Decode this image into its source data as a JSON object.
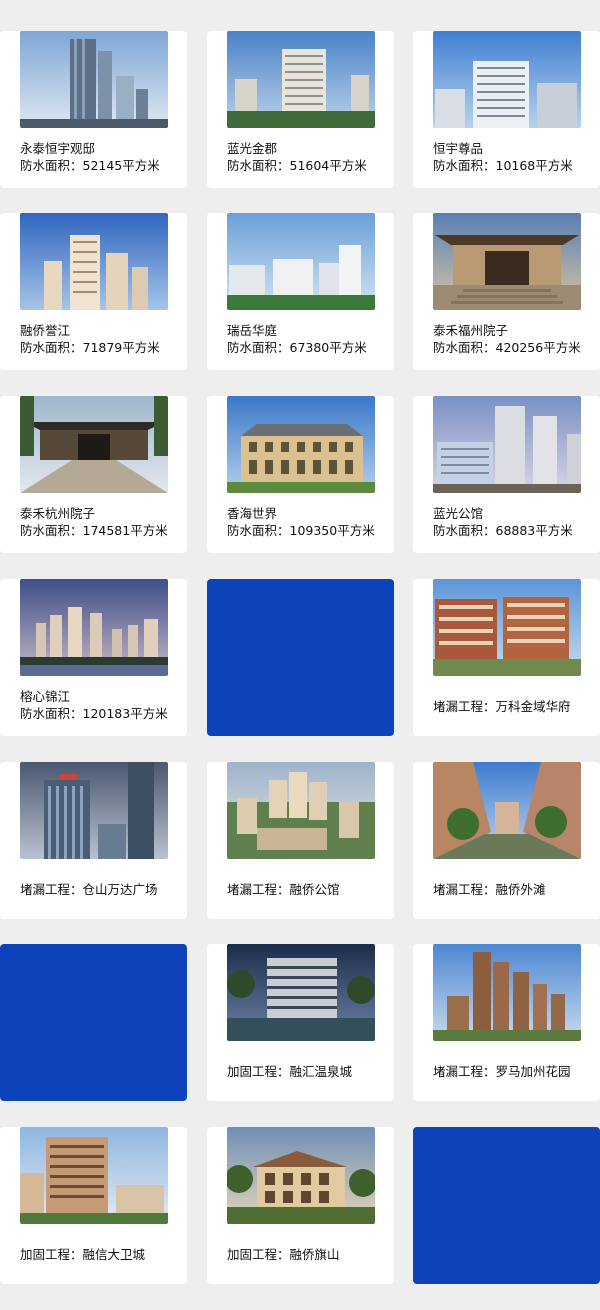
{
  "projects": [
    {
      "title": "永泰恒宇观邸",
      "area": "防水面积：52145平方米",
      "scene": "towers-blue"
    },
    {
      "title": "蓝光金郡",
      "area": "防水面积：51604平方米",
      "scene": "mid-rise-cream"
    },
    {
      "title": "恒宇尊品",
      "area": "防水面积：10168平方米",
      "scene": "highrise-white"
    },
    {
      "title": "融侨誉江",
      "area": "防水面积：71879平方米",
      "scene": "towers-sunset"
    },
    {
      "title": "瑞岳华庭",
      "area": "防水面积：67380平方米",
      "scene": "slab-blocks-green"
    },
    {
      "title": "泰禾福州院子",
      "area": "防水面积：420256平方米",
      "scene": "chinese-gate"
    },
    {
      "title": "泰禾杭州院子",
      "area": "防水面积：174581平方米",
      "scene": "courtyard-gate"
    },
    {
      "title": "香海世界",
      "area": "防水面积：109350平方米",
      "scene": "european-villa"
    },
    {
      "title": "蓝光公馆",
      "area": "防水面积：68883平方米",
      "scene": "glass-towers"
    },
    {
      "title": "榕心锦江",
      "area": "防水面积：120183平方米",
      "scene": "river-skyline"
    },
    {
      "title": "",
      "area": "",
      "scene": "blue-tile"
    },
    {
      "title": "堵漏工程：万科金域华府",
      "area": "",
      "scene": "brick-apartments"
    },
    {
      "title": "堵漏工程：仓山万达广场",
      "area": "",
      "scene": "dark-towers"
    },
    {
      "title": "堵漏工程：融侨公馆",
      "area": "",
      "scene": "aerial-residential"
    },
    {
      "title": "堵漏工程：融侨外滩",
      "area": "",
      "scene": "street-view"
    },
    {
      "title": "",
      "area": "",
      "scene": "blue-tile"
    },
    {
      "title": "加固工程：融汇温泉城",
      "area": "",
      "scene": "modern-night"
    },
    {
      "title": "堵漏工程：罗马加州花园",
      "area": "",
      "scene": "brown-towers"
    },
    {
      "title": "加固工程：融信大卫城",
      "area": "",
      "scene": "stepped-tower"
    },
    {
      "title": "加固工程：融侨旗山",
      "area": "",
      "scene": "hillside-villa"
    },
    {
      "title": "",
      "area": "",
      "scene": "blue-tile"
    }
  ],
  "colors": {
    "page_bg": "#eeeeee",
    "card_bg": "#ffffff",
    "accent_tile": "#0c43bb"
  }
}
